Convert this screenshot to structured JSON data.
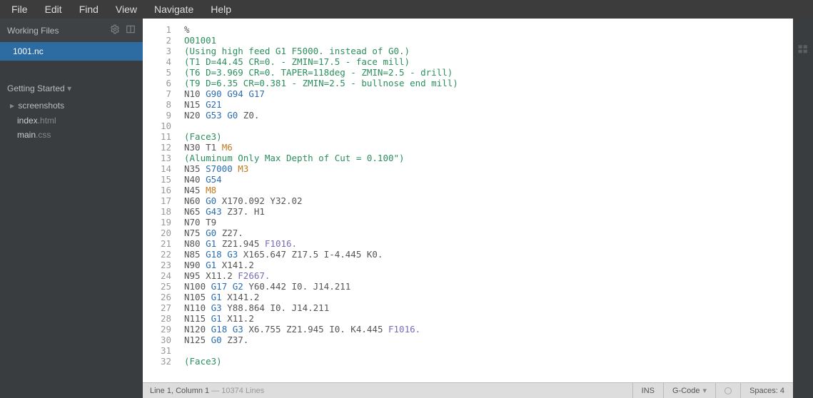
{
  "menu": [
    "File",
    "Edit",
    "Find",
    "View",
    "Navigate",
    "Help"
  ],
  "sidebar": {
    "working_files_label": "Working Files",
    "working_files": [
      {
        "name": "1001.nc",
        "active": true
      }
    ],
    "getting_started_label": "Getting Started",
    "tree": {
      "folder": "screenshots",
      "files": [
        {
          "base": "index",
          "ext": ".html"
        },
        {
          "base": "main",
          "ext": ".css"
        }
      ]
    }
  },
  "editor": {
    "lines": [
      {
        "raw": "%",
        "tokens": [
          {
            "t": "%",
            "c": "coord"
          }
        ]
      },
      {
        "raw": "O01001",
        "tokens": [
          {
            "t": "O01001",
            "c": "comment"
          }
        ]
      },
      {
        "raw": "(Using high feed G1 F5000. instead of G0.)",
        "tokens": [
          {
            "t": "(Using high feed G1 F5000. instead of G0.)",
            "c": "comment"
          }
        ]
      },
      {
        "raw": "(T1 D=44.45 CR=0. - ZMIN=17.5 - face mill)",
        "tokens": [
          {
            "t": "(T1 D=44.45 CR=0. - ZMIN=17.5 - face mill)",
            "c": "comment"
          }
        ]
      },
      {
        "raw": "(T6 D=3.969 CR=0. TAPER=118deg - ZMIN=2.5 - drill)",
        "tokens": [
          {
            "t": "(T6 D=3.969 CR=0. TAPER=118deg - ZMIN=2.5 - drill)",
            "c": "comment"
          }
        ]
      },
      {
        "raw": "(T9 D=6.35 CR=0.381 - ZMIN=2.5 - bullnose end mill)",
        "tokens": [
          {
            "t": "(T9 D=6.35 CR=0.381 - ZMIN=2.5 - bullnose end mill)",
            "c": "comment"
          }
        ]
      },
      {
        "raw": "N10 G90 G94 G17",
        "tokens": [
          {
            "t": "N10 ",
            "c": "coord"
          },
          {
            "t": "G90 G94 G17",
            "c": "keyword"
          }
        ]
      },
      {
        "raw": "N15 G21",
        "tokens": [
          {
            "t": "N15 ",
            "c": "coord"
          },
          {
            "t": "G21",
            "c": "keyword"
          }
        ]
      },
      {
        "raw": "N20 G53 G0 Z0.",
        "tokens": [
          {
            "t": "N20 ",
            "c": "coord"
          },
          {
            "t": "G53 G0",
            "c": "keyword"
          },
          {
            "t": " Z0.",
            "c": "coord"
          }
        ]
      },
      {
        "raw": "",
        "tokens": []
      },
      {
        "raw": "(Face3)",
        "tokens": [
          {
            "t": "(Face3)",
            "c": "comment"
          }
        ]
      },
      {
        "raw": "N30 T1 M6",
        "tokens": [
          {
            "t": "N30 T1 ",
            "c": "coord"
          },
          {
            "t": "M6",
            "c": "warn"
          }
        ]
      },
      {
        "raw": "(Aluminum Only Max Depth of Cut = 0.100\")",
        "tokens": [
          {
            "t": "(Aluminum Only Max Depth of Cut = 0.100\")",
            "c": "comment"
          }
        ]
      },
      {
        "raw": "N35 S7000 M3",
        "tokens": [
          {
            "t": "N35 ",
            "c": "coord"
          },
          {
            "t": "S7000",
            "c": "keyword"
          },
          {
            "t": " ",
            "c": "coord"
          },
          {
            "t": "M3",
            "c": "warn"
          }
        ]
      },
      {
        "raw": "N40 G54",
        "tokens": [
          {
            "t": "N40 ",
            "c": "coord"
          },
          {
            "t": "G54",
            "c": "keyword"
          }
        ]
      },
      {
        "raw": "N45 M8",
        "tokens": [
          {
            "t": "N45 ",
            "c": "coord"
          },
          {
            "t": "M8",
            "c": "warn"
          }
        ]
      },
      {
        "raw": "N60 G0 X170.092 Y32.02",
        "tokens": [
          {
            "t": "N60 ",
            "c": "coord"
          },
          {
            "t": "G0",
            "c": "keyword"
          },
          {
            "t": " X170.092 Y32.02",
            "c": "coord"
          }
        ]
      },
      {
        "raw": "N65 G43 Z37. H1",
        "tokens": [
          {
            "t": "N65 ",
            "c": "coord"
          },
          {
            "t": "G43",
            "c": "keyword"
          },
          {
            "t": " Z37. H1",
            "c": "coord"
          }
        ]
      },
      {
        "raw": "N70 T9",
        "tokens": [
          {
            "t": "N70 T9",
            "c": "coord"
          }
        ]
      },
      {
        "raw": "N75 G0 Z27.",
        "tokens": [
          {
            "t": "N75 ",
            "c": "coord"
          },
          {
            "t": "G0",
            "c": "keyword"
          },
          {
            "t": " Z27.",
            "c": "coord"
          }
        ]
      },
      {
        "raw": "N80 G1 Z21.945 F1016.",
        "tokens": [
          {
            "t": "N80 ",
            "c": "coord"
          },
          {
            "t": "G1",
            "c": "keyword"
          },
          {
            "t": " Z21.945 ",
            "c": "coord"
          },
          {
            "t": "F1016.",
            "c": "param"
          }
        ]
      },
      {
        "raw": "N85 G18 G3 X165.647 Z17.5 I-4.445 K0.",
        "tokens": [
          {
            "t": "N85 ",
            "c": "coord"
          },
          {
            "t": "G18 G3",
            "c": "keyword"
          },
          {
            "t": " X165.647 Z17.5 I-4.445 K0.",
            "c": "coord"
          }
        ]
      },
      {
        "raw": "N90 G1 X141.2",
        "tokens": [
          {
            "t": "N90 ",
            "c": "coord"
          },
          {
            "t": "G1",
            "c": "keyword"
          },
          {
            "t": " X141.2",
            "c": "coord"
          }
        ]
      },
      {
        "raw": "N95 X11.2 F2667.",
        "tokens": [
          {
            "t": "N95 X11.2 ",
            "c": "coord"
          },
          {
            "t": "F2667.",
            "c": "param"
          }
        ]
      },
      {
        "raw": "N100 G17 G2 Y60.442 I0. J14.211",
        "tokens": [
          {
            "t": "N100 ",
            "c": "coord"
          },
          {
            "t": "G17 G2",
            "c": "keyword"
          },
          {
            "t": " Y60.442 I0. J14.211",
            "c": "coord"
          }
        ]
      },
      {
        "raw": "N105 G1 X141.2",
        "tokens": [
          {
            "t": "N105 ",
            "c": "coord"
          },
          {
            "t": "G1",
            "c": "keyword"
          },
          {
            "t": " X141.2",
            "c": "coord"
          }
        ]
      },
      {
        "raw": "N110 G3 Y88.864 I0. J14.211",
        "tokens": [
          {
            "t": "N110 ",
            "c": "coord"
          },
          {
            "t": "G3",
            "c": "keyword"
          },
          {
            "t": " Y88.864 I0. J14.211",
            "c": "coord"
          }
        ]
      },
      {
        "raw": "N115 G1 X11.2",
        "tokens": [
          {
            "t": "N115 ",
            "c": "coord"
          },
          {
            "t": "G1",
            "c": "keyword"
          },
          {
            "t": " X11.2",
            "c": "coord"
          }
        ]
      },
      {
        "raw": "N120 G18 G3 X6.755 Z21.945 I0. K4.445 F1016.",
        "tokens": [
          {
            "t": "N120 ",
            "c": "coord"
          },
          {
            "t": "G18 G3",
            "c": "keyword"
          },
          {
            "t": " X6.755 Z21.945 I0. K4.445 ",
            "c": "coord"
          },
          {
            "t": "F1016.",
            "c": "param"
          }
        ]
      },
      {
        "raw": "N125 G0 Z37.",
        "tokens": [
          {
            "t": "N125 ",
            "c": "coord"
          },
          {
            "t": "G0",
            "c": "keyword"
          },
          {
            "t": " Z37.",
            "c": "coord"
          }
        ]
      },
      {
        "raw": "",
        "tokens": []
      },
      {
        "raw": "(Face3)",
        "tokens": [
          {
            "t": "(Face3)",
            "c": "comment"
          }
        ]
      }
    ]
  },
  "statusbar": {
    "position": "Line 1, Column 1",
    "separator": " — ",
    "linecount": "10374 Lines",
    "ins": "INS",
    "language": "G-Code",
    "spaces": "Spaces: 4"
  }
}
